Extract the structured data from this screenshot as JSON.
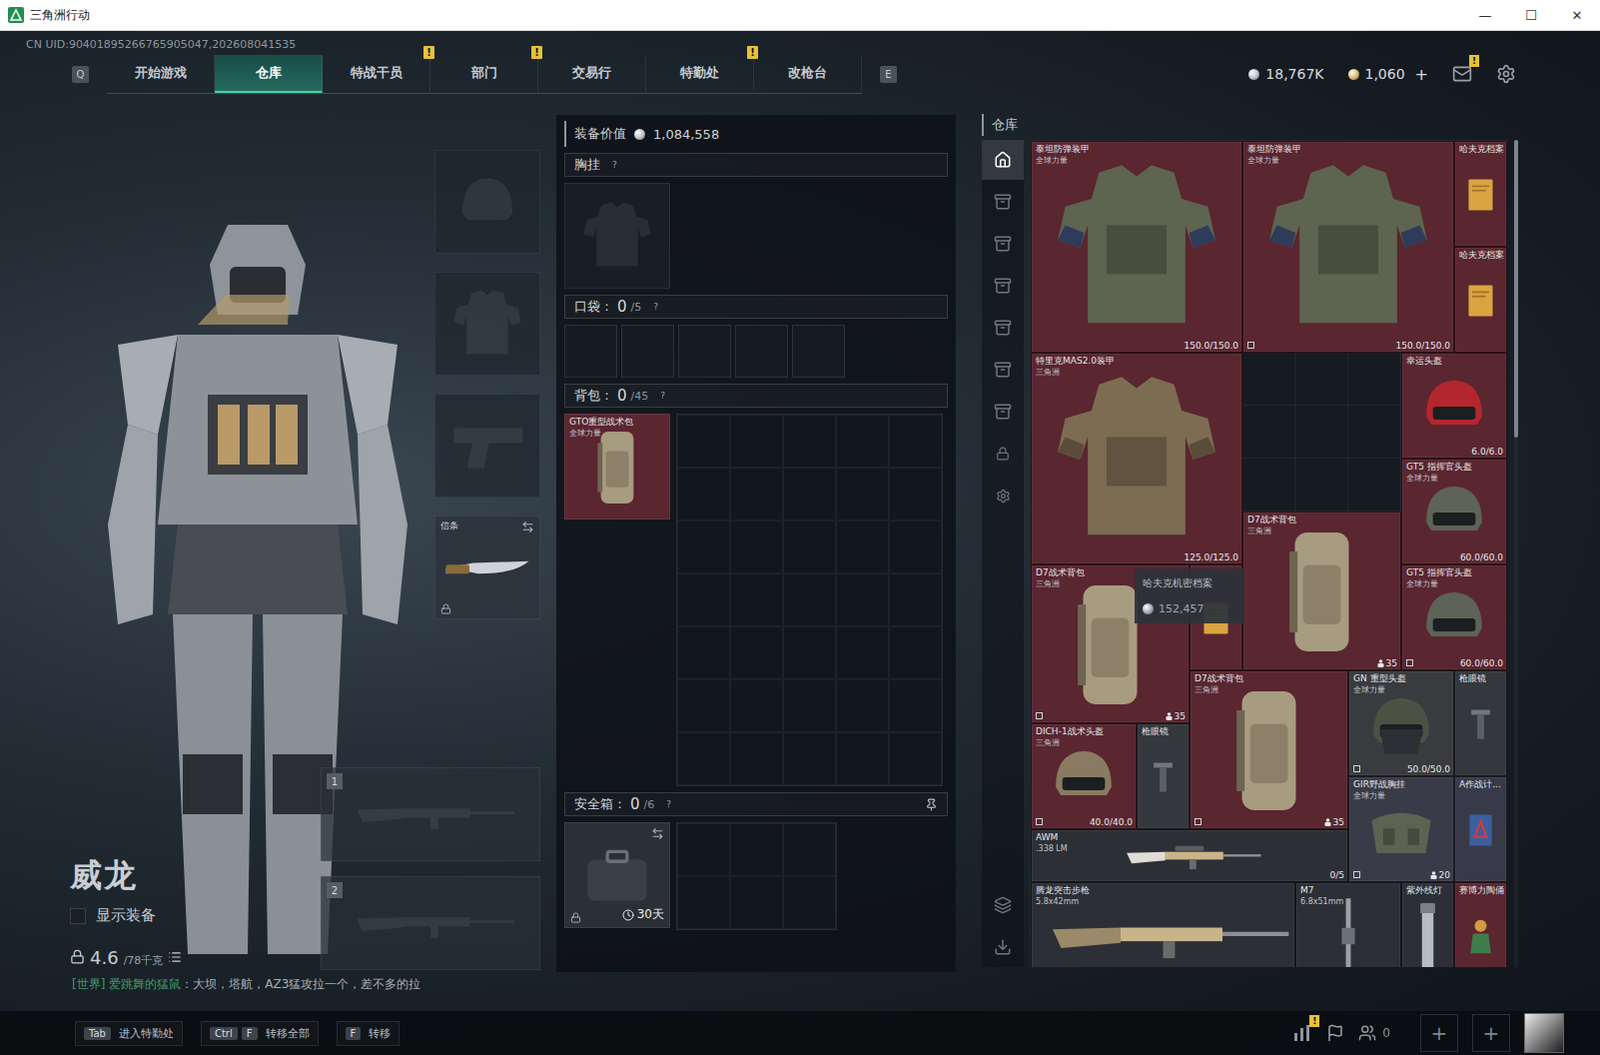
{
  "window": {
    "title": "三角洲行动",
    "controls": [
      "—",
      "☐",
      "✕"
    ]
  },
  "uid": "CN UID:90401895266765905047,202608041535",
  "nav": {
    "left_key": "Q",
    "right_key": "E",
    "tabs": [
      {
        "label": "开始游戏",
        "selected": false,
        "badge": ""
      },
      {
        "label": "仓库",
        "selected": true,
        "badge": ""
      },
      {
        "label": "特战干员",
        "selected": false,
        "badge": "!"
      },
      {
        "label": "部门",
        "selected": false,
        "badge": "!"
      },
      {
        "label": "交易行",
        "selected": false,
        "badge": ""
      },
      {
        "label": "特勤处",
        "selected": false,
        "badge": "!"
      },
      {
        "label": "改枪台",
        "selected": false,
        "badge": ""
      }
    ]
  },
  "currencies": [
    {
      "amount": "18,767K",
      "color": "#b9bec4",
      "add": ""
    },
    {
      "amount": "1,060",
      "color": "#d8b56a",
      "add": "+"
    }
  ],
  "mail": {
    "badge": "!"
  },
  "character": {
    "name": "威龙",
    "show_gear": {
      "label": "显示装备",
      "checked": false
    },
    "weight": "4.6",
    "weight_max": "/78千克"
  },
  "chat": {
    "channel": "[世界]",
    "sender": "爱跳舞的猛鼠",
    "message": "：大坝，塔航，AZ3猛攻拉一个，差不多的拉"
  },
  "gear_slots": [
    {
      "kind": "helmet",
      "filled": false,
      "label": "",
      "locked": false
    },
    {
      "kind": "armor",
      "filled": false,
      "label": "",
      "locked": false
    },
    {
      "kind": "pistol",
      "filled": false,
      "label": "",
      "locked": false
    },
    {
      "kind": "knife",
      "filled": true,
      "label": "信条",
      "locked": true
    }
  ],
  "weapon_slots": [
    {
      "number": "1"
    },
    {
      "number": "2"
    }
  ],
  "loadout": {
    "value_label": "装备价值",
    "value": "1,084,558",
    "chest": {
      "title": "胸挂",
      "help": "?"
    },
    "pockets": {
      "title": "口袋：",
      "count": "0",
      "capacity": "/5",
      "help": "?",
      "cells": 5
    },
    "backpack": {
      "title": "背包：",
      "count": "0",
      "capacity": "/45",
      "help": "?",
      "item": {
        "name": "GTO重型战术包",
        "sub": "全球力量",
        "color": "#5a2630"
      }
    },
    "secure": {
      "title": "安全箱：",
      "count": "0",
      "capacity": "/6",
      "help": "?",
      "locked": true,
      "days": "30天"
    }
  },
  "warehouse": {
    "title": "仓库",
    "tabs": [
      {
        "kind": "home",
        "selected": true
      },
      {
        "kind": "stash",
        "selected": false
      },
      {
        "kind": "stash",
        "selected": false
      },
      {
        "kind": "stash",
        "selected": false
      },
      {
        "kind": "stash",
        "selected": false
      },
      {
        "kind": "stash",
        "selected": false
      },
      {
        "kind": "stash",
        "selected": false
      },
      {
        "kind": "lock",
        "selected": false
      },
      {
        "kind": "settings",
        "selected": false
      }
    ],
    "tools": [
      {
        "kind": "layers"
      },
      {
        "kind": "transfer"
      }
    ],
    "scroll": {
      "thumb": 0.36,
      "position": 0
    },
    "items": [
      {
        "name": "泰坦防弹装甲",
        "sub": "全球力量",
        "kind": "armor",
        "color": "#5a2630",
        "durability": "150.0/150.0",
        "count": "",
        "ammo": "",
        "marked": false,
        "hovered": false,
        "price": ""
      },
      {
        "name": "泰坦防弹装甲",
        "sub": "全球力量",
        "kind": "armor",
        "color": "#5a2630",
        "durability": "150.0/150.0",
        "count": "",
        "ammo": "",
        "marked": true,
        "hovered": false,
        "price": ""
      },
      {
        "name": "哈夫克档案",
        "sub": "",
        "kind": "document",
        "color": "#5a2630",
        "durability": "",
        "count": "",
        "ammo": "",
        "marked": false,
        "hovered": false,
        "price": ""
      },
      {
        "name": "哈夫克档案",
        "sub": "",
        "kind": "document",
        "color": "#5a2630",
        "durability": "",
        "count": "",
        "ammo": "",
        "marked": false,
        "hovered": false,
        "price": ""
      },
      {
        "name": "特里克MAS2.0装甲",
        "sub": "三角洲",
        "kind": "armor-camo",
        "color": "#5a2630",
        "durability": "125.0/125.0",
        "count": "",
        "ammo": "",
        "marked": false,
        "hovered": false,
        "price": ""
      },
      {
        "name": "幸运头盔",
        "sub": "",
        "kind": "helmet-red",
        "color": "#5a2630",
        "durability": "6.0/6.0",
        "count": "",
        "ammo": "",
        "marked": false,
        "hovered": false,
        "price": ""
      },
      {
        "name": "GT5 指挥官头盔",
        "sub": "全球力量",
        "kind": "helmet",
        "color": "#5a2630",
        "durability": "60.0/60.0",
        "count": "",
        "ammo": "",
        "marked": false,
        "hovered": false,
        "price": ""
      },
      {
        "name": "D7战术背包",
        "sub": "三角洲",
        "kind": "backpack",
        "color": "#5a2630",
        "durability": "",
        "count": "35",
        "ammo": "",
        "marked": false,
        "hovered": false,
        "price": ""
      },
      {
        "name": "D7战术背包",
        "sub": "三角洲",
        "kind": "backpack",
        "color": "#5a2630",
        "durability": "",
        "count": "35",
        "ammo": "",
        "marked": true,
        "hovered": false,
        "price": ""
      },
      {
        "name": "哈夫克机密档案",
        "sub": "",
        "kind": "document",
        "color": "#5a2630",
        "durability": "",
        "count": "",
        "ammo": "",
        "marked": false,
        "hovered": true,
        "price": "152,457"
      },
      {
        "name": "GT5 指挥官头盔",
        "sub": "全球力量",
        "kind": "helmet",
        "color": "#5a2630",
        "durability": "60.0/60.0",
        "count": "",
        "ammo": "",
        "marked": true,
        "hovered": false,
        "price": ""
      },
      {
        "name": "D7战术背包",
        "sub": "三角洲",
        "kind": "backpack",
        "color": "#5a2630",
        "durability": "",
        "count": "35",
        "ammo": "",
        "marked": true,
        "hovered": false,
        "price": ""
      },
      {
        "name": "GN 重型头盔",
        "sub": "全球力量",
        "kind": "helmet-heavy",
        "color": "#3a3b3e",
        "durability": "50.0/50.0",
        "count": "",
        "ammo": "",
        "marked": true,
        "hovered": false,
        "price": ""
      },
      {
        "name": "枪眼镜",
        "sub": "",
        "kind": "scope",
        "color": "#34373c",
        "durability": "",
        "count": "",
        "ammo": "",
        "marked": false,
        "hovered": false,
        "price": ""
      },
      {
        "name": "DICH-1战术头盔",
        "sub": "三角洲",
        "kind": "helmet-tan",
        "color": "#5a2630",
        "durability": "40.0/40.0",
        "count": "",
        "ammo": "",
        "marked": true,
        "hovered": false,
        "price": ""
      },
      {
        "name": "枪眼镜",
        "sub": "",
        "kind": "scope",
        "color": "#34373c",
        "durability": "",
        "count": "",
        "ammo": "",
        "marked": false,
        "hovered": false,
        "price": ""
      },
      {
        "name": "GIR野战胸挂",
        "sub": "全球力量",
        "kind": "rig",
        "color": "#393b48",
        "durability": "",
        "count": "20",
        "ammo": "",
        "marked": true,
        "hovered": false,
        "price": ""
      },
      {
        "name": "A作战计...",
        "sub": "",
        "kind": "book",
        "color": "#383a4a",
        "durability": "",
        "count": "",
        "ammo": "",
        "marked": false,
        "hovered": false,
        "price": ""
      },
      {
        "name": "AWM",
        "sub": ".338 LM",
        "kind": "rifle-sniper",
        "color": "#2c3036",
        "durability": "",
        "count": "",
        "ammo": "0/5",
        "marked": false,
        "hovered": false,
        "price": ""
      },
      {
        "name": "腾龙突击步枪",
        "sub": "5.8x42mm",
        "kind": "rifle",
        "color": "#2c3036",
        "durability": "",
        "count": "",
        "ammo": "",
        "marked": false,
        "hovered": false,
        "price": ""
      },
      {
        "name": "M7",
        "sub": "6.8x51mm",
        "kind": "rifle-vertical",
        "color": "#2c3036",
        "durability": "",
        "count": "",
        "ammo": "",
        "marked": false,
        "hovered": false,
        "price": ""
      },
      {
        "name": "紫外线灯",
        "sub": "",
        "kind": "light",
        "color": "#2c3036",
        "durability": "",
        "count": "",
        "ammo": "",
        "marked": false,
        "hovered": false,
        "price": ""
      },
      {
        "name": "赛博力陶俑",
        "sub": "",
        "kind": "figure",
        "color": "#5a2630",
        "durability": "",
        "count": "",
        "ammo": "",
        "marked": false,
        "hovered": false,
        "price": ""
      }
    ]
  },
  "bottom": {
    "hints": [
      {
        "keys": [
          "Tab"
        ],
        "label": "进入特勤处"
      },
      {
        "keys": [
          "Ctrl",
          "F"
        ],
        "label": "转移全部"
      },
      {
        "keys": [
          "F"
        ],
        "label": "转移"
      }
    ],
    "stats_badge": "!",
    "friends": "0",
    "add_slots": [
      "+",
      "+"
    ]
  }
}
